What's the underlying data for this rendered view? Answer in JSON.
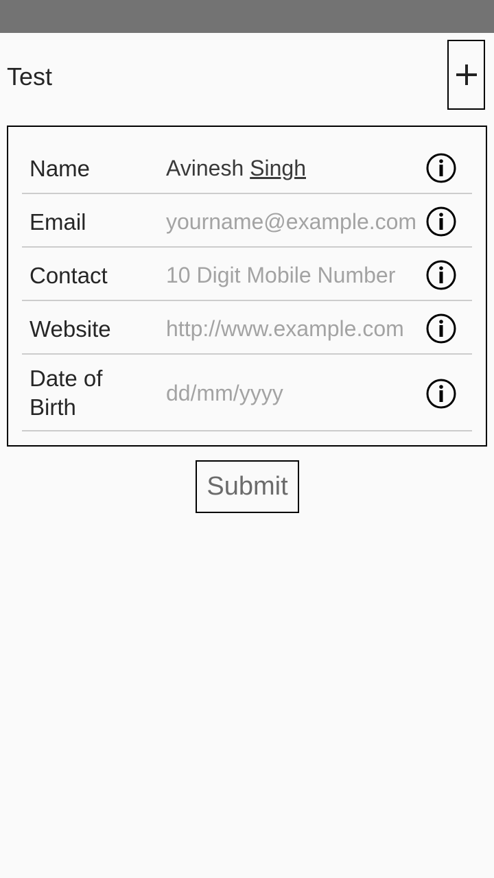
{
  "status_bar": {
    "color": "#737373"
  },
  "header": {
    "title": "Test",
    "add_icon": "plus-icon"
  },
  "form": {
    "name": {
      "label": "Name",
      "value_first": "Avinesh",
      "value_last": "Singh",
      "info_icon": "info-icon"
    },
    "email": {
      "label": "Email",
      "placeholder": "yourname@example.com",
      "info_icon": "info-icon"
    },
    "contact": {
      "label": "Contact",
      "placeholder": "10 Digit Mobile Number",
      "info_icon": "info-icon"
    },
    "website": {
      "label": "Website",
      "placeholder": "http://www.example.com",
      "info_icon": "info-icon"
    },
    "dob": {
      "label_line1": "Date of",
      "label_line2": "Birth",
      "placeholder": "dd/mm/yyyy",
      "info_icon": "info-icon"
    }
  },
  "submit": {
    "label": "Submit"
  }
}
